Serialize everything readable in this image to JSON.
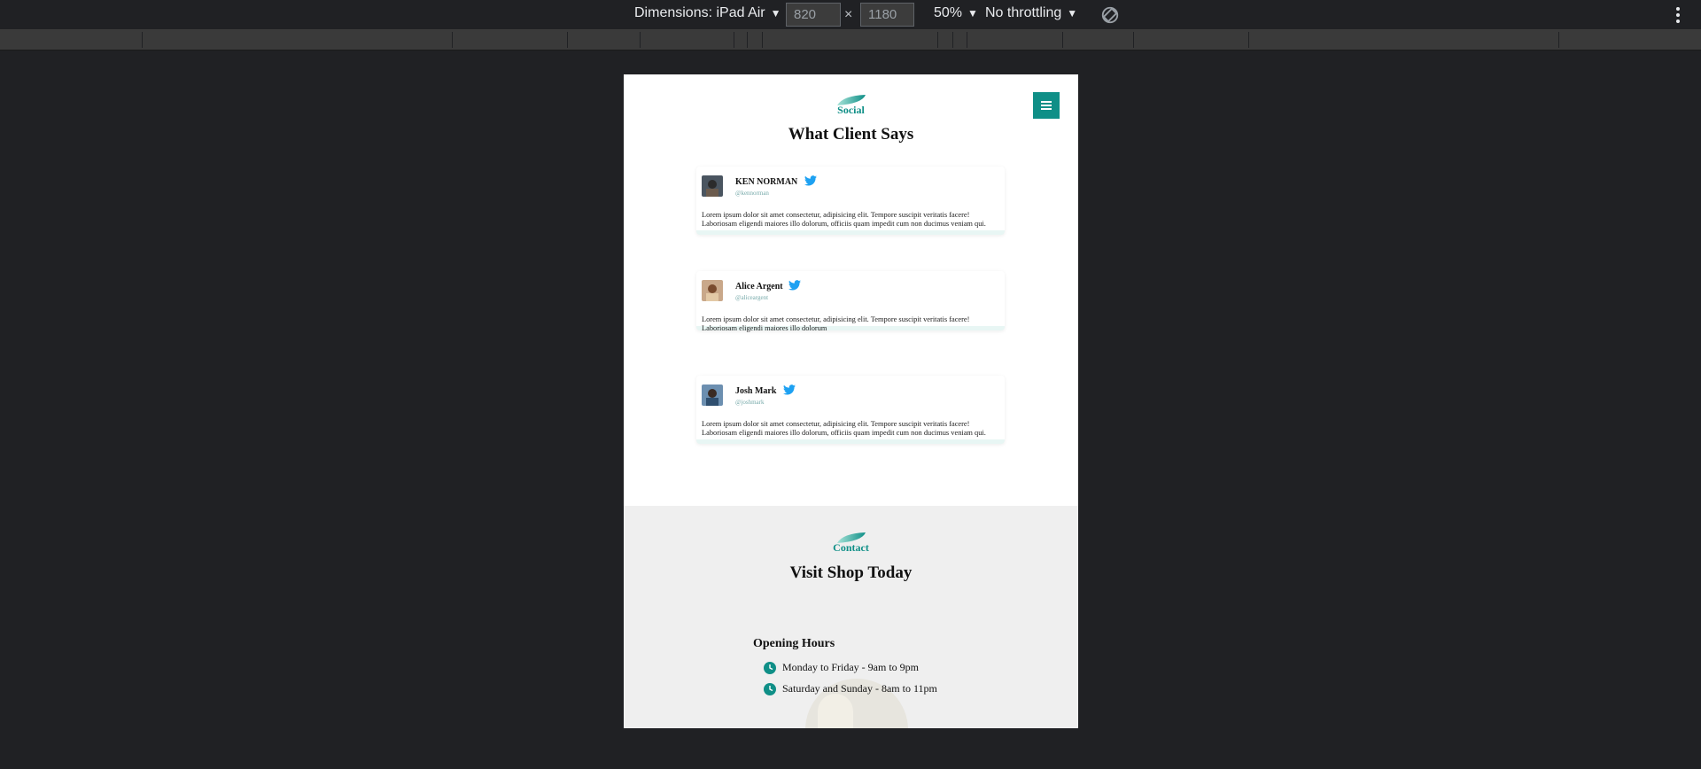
{
  "devtools": {
    "dimensions_label": "Dimensions: iPad Air",
    "width_value": "820",
    "height_value": "1180",
    "times_sign": "×",
    "zoom_label": "50%",
    "throttle_label": "No throttling",
    "caret": "▼"
  },
  "social": {
    "tag": "Social",
    "title": "What Client Says",
    "testimonials": [
      {
        "name": "KEN NORMAN",
        "handle": "@kennorman",
        "text": "Lorem ipsum dolor sit amet consectetur, adipisicing elit. Tempore suscipit veritatis facere! Laboriosam eligendi maiores illo dolorum, officiis quam impedit cum non ducimus veniam qui."
      },
      {
        "name": "Alice Argent",
        "handle": "@aliceargent",
        "text": "Lorem ipsum dolor sit amet consectetur, adipisicing elit. Tempore suscipit veritatis facere! Laboriosam eligendi maiores illo dolorum"
      },
      {
        "name": "Josh Mark",
        "handle": "@joshmark",
        "text": "Lorem ipsum dolor sit amet consectetur, adipisicing elit. Tempore suscipit veritatis facere! Laboriosam eligendi maiores illo dolorum, officiis quam impedit cum non ducimus veniam qui."
      }
    ]
  },
  "contact": {
    "tag": "Contact",
    "title": "Visit Shop Today",
    "hours_title": "Opening Hours",
    "hours": [
      "Monday to Friday - 9am to 9pm",
      "Saturday and Sunday - 8am to 11pm"
    ]
  },
  "colors": {
    "accent": "#0f8f87",
    "twitter": "#1da1f2",
    "devtools_bg": "#202124",
    "contact_bg": "#efefef"
  },
  "icons": [
    "menu-icon",
    "twitter-icon",
    "clock-icon",
    "leaf-icon",
    "rotate-icon",
    "more-vert-icon"
  ]
}
